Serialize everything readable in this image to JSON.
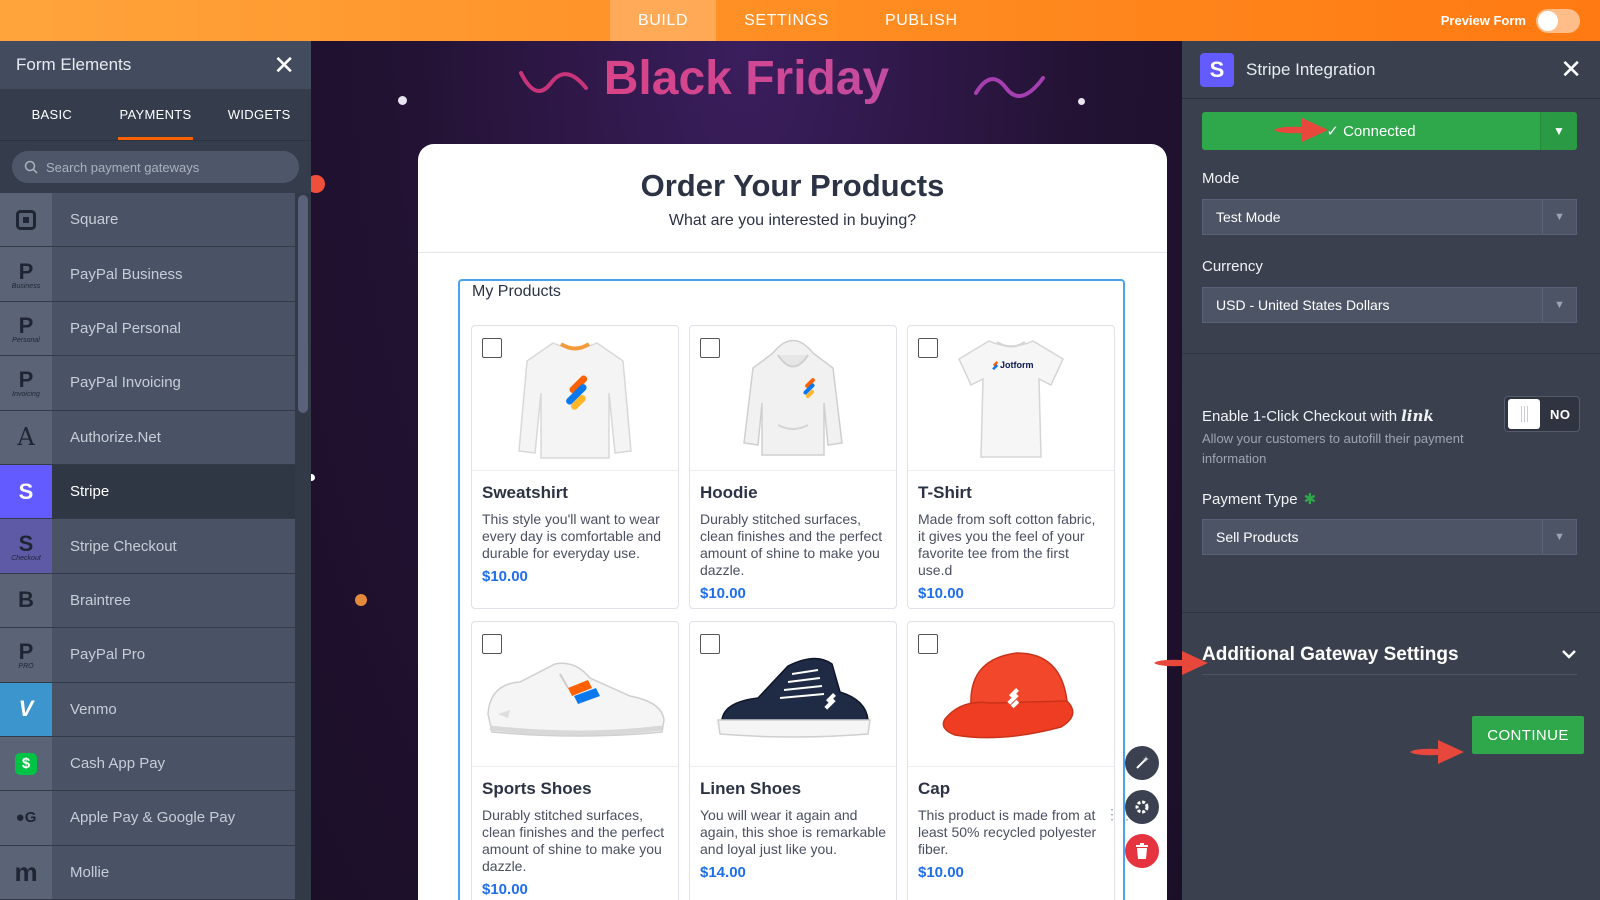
{
  "topbar": {
    "tabs": [
      {
        "label": "BUILD",
        "active": true
      },
      {
        "label": "SETTINGS",
        "active": false
      },
      {
        "label": "PUBLISH",
        "active": false
      }
    ],
    "preview_label": "Preview Form",
    "preview_on": false
  },
  "left_panel": {
    "title": "Form Elements",
    "tabs": [
      {
        "label": "BASIC"
      },
      {
        "label": "PAYMENTS",
        "active": true
      },
      {
        "label": "WIDGETS"
      }
    ],
    "search_placeholder": "Search payment gateways",
    "gateways": [
      {
        "name": "Square",
        "icon": "square-icon"
      },
      {
        "name": "PayPal Business",
        "icon": "paypal-icon",
        "sub": "Business"
      },
      {
        "name": "PayPal Personal",
        "icon": "paypal-icon",
        "sub": "Personal"
      },
      {
        "name": "PayPal Invoicing",
        "icon": "paypal-icon",
        "sub": "Invoicing"
      },
      {
        "name": "Authorize.Net",
        "icon": "authorize-icon"
      },
      {
        "name": "Stripe",
        "icon": "stripe-icon",
        "active": true
      },
      {
        "name": "Stripe Checkout",
        "icon": "stripe-icon",
        "sub": "Checkout"
      },
      {
        "name": "Braintree",
        "icon": "braintree-icon"
      },
      {
        "name": "PayPal Pro",
        "icon": "paypal-icon",
        "sub": "PRO"
      },
      {
        "name": "Venmo",
        "icon": "venmo-icon"
      },
      {
        "name": "Cash App Pay",
        "icon": "cash-app-icon"
      },
      {
        "name": "Apple Pay & Google Pay",
        "icon": "apple-google-icon"
      },
      {
        "name": "Mollie",
        "icon": "mollie-icon"
      }
    ]
  },
  "canvas": {
    "banner_title": "Black Friday",
    "form_title": "Order Your Products",
    "form_subtitle": "What are you interested in buying?",
    "products_label": "My Products",
    "products": [
      {
        "name": "Sweatshirt",
        "desc": "This style you'll want to wear every day is comfortable and durable for everyday use.",
        "price": "$10.00",
        "icon": "sweatshirt-icon"
      },
      {
        "name": "Hoodie",
        "desc": "Durably stitched surfaces, clean finishes and the perfect amount of shine to make you dazzle.",
        "price": "$10.00",
        "icon": "hoodie-icon"
      },
      {
        "name": "T-Shirt",
        "desc": "Made from soft cotton fabric, it gives you the feel of your favorite tee from the first use.d",
        "price": "$10.00",
        "icon": "tshirt-icon",
        "brand": "Jotform"
      },
      {
        "name": "Sports Shoes",
        "desc": "Durably stitched surfaces, clean finishes and the perfect amount of shine to make you dazzle.",
        "price": "$10.00",
        "icon": "sneaker-icon"
      },
      {
        "name": "Linen Shoes",
        "desc": "You will wear it again and again, this shoe is remarkable and loyal just like you.",
        "price": "$14.00",
        "icon": "hightop-shoe-icon"
      },
      {
        "name": "Cap",
        "desc": "This product is made from at least 50% recycled polyester fiber.",
        "price": "$10.00",
        "icon": "cap-icon"
      }
    ]
  },
  "right_panel": {
    "title": "Stripe Integration",
    "connected_label": "✓ Connected",
    "mode_label": "Mode",
    "mode_value": "Test Mode",
    "currency_label": "Currency",
    "currency_value": "USD - United States Dollars",
    "oneclick_label": "Enable 1-Click Checkout with",
    "oneclick_brand": "link",
    "oneclick_desc": "Allow your customers to autofill their payment information",
    "oneclick_value": "NO",
    "payment_type_label": "Payment Type",
    "payment_type_value": "Sell Products",
    "additional_settings": "Additional Gateway Settings",
    "continue_label": "CONTINUE"
  },
  "colors": {
    "topbar_orange": "#ff8a1f",
    "stripe_purple": "#635bff",
    "connected_green": "#2ea84a",
    "price_blue": "#1f6feb",
    "arrow_red": "#e8473b"
  }
}
